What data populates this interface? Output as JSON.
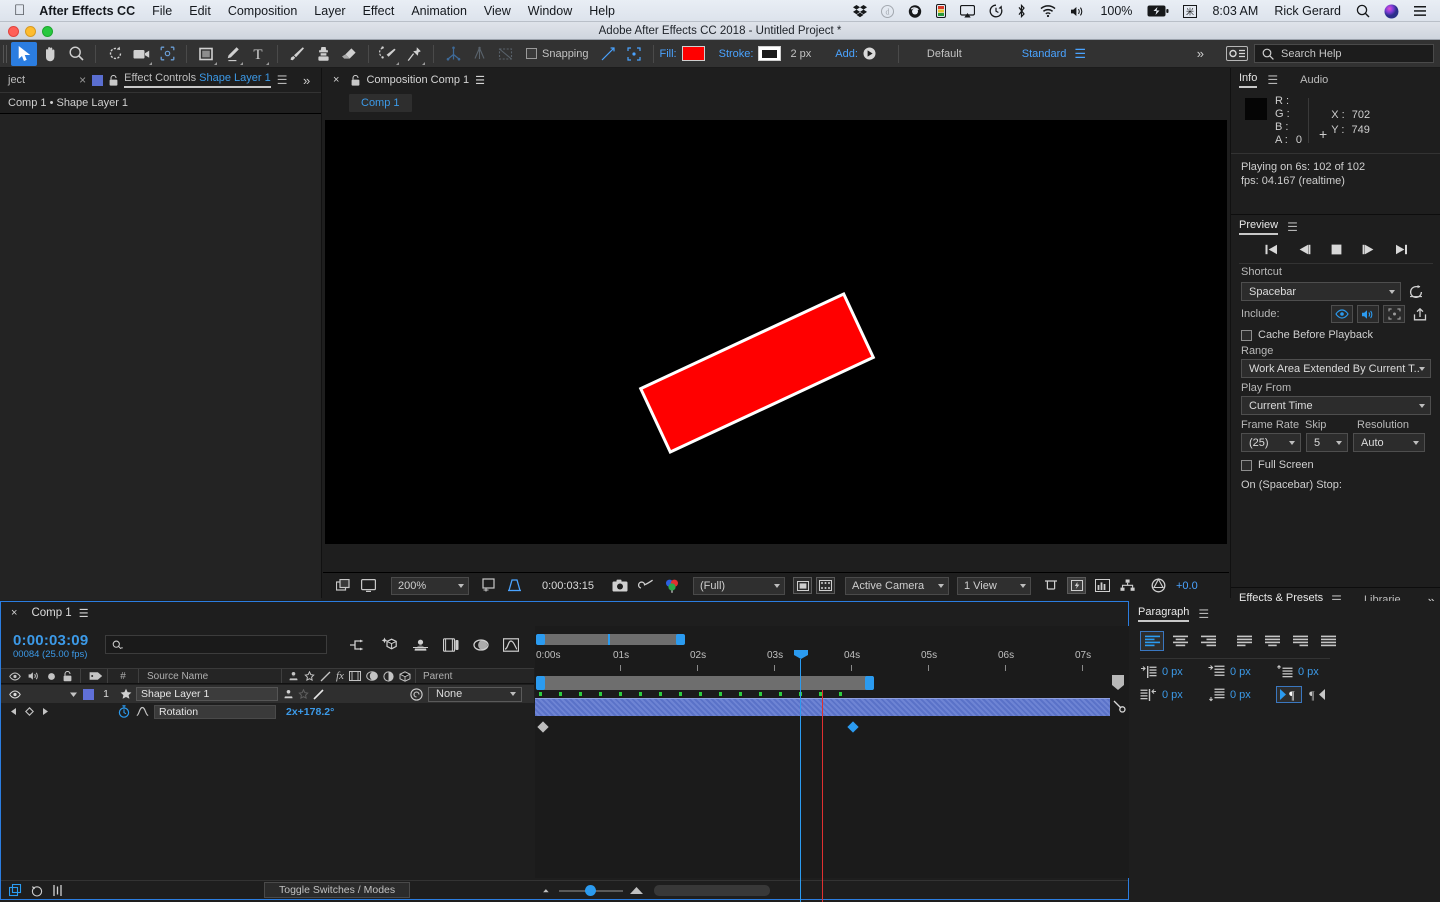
{
  "macbar": {
    "apple_icon": "apple-icon",
    "app_name": "After Effects CC",
    "menus": [
      "File",
      "Edit",
      "Composition",
      "Layer",
      "Effect",
      "Animation",
      "View",
      "Window",
      "Help"
    ],
    "status_icons": [
      "dropbox-icon",
      "dictation-icon",
      "creative-cloud-icon",
      "battery-monitor-icon",
      "airplay-icon",
      "timemachine-icon",
      "bluetooth-icon",
      "wifi-icon",
      "volume-icon"
    ],
    "battery_percent": "100%",
    "battery_icon": "battery-charging-icon",
    "keyboard_icon": "input-source-icon",
    "time": "8:03 AM",
    "user": "Rick Gerard",
    "search_icon": "spotlight-search-icon",
    "siri_icon": "siri-icon",
    "notification_icon": "notification-center-icon"
  },
  "titlebar": {
    "title": "Adobe After Effects CC 2018 - Untitled Project *"
  },
  "toolbar": {
    "tools": [
      {
        "name": "selection-tool",
        "glyph": "arrow",
        "active": true
      },
      {
        "name": "hand-tool",
        "glyph": "hand",
        "active": false
      },
      {
        "name": "zoom-tool",
        "glyph": "magnifier",
        "active": false
      },
      {
        "name": "rotation-tool",
        "glyph": "rotate",
        "active": false
      },
      {
        "name": "camera-tool",
        "glyph": "camera",
        "active": false
      },
      {
        "name": "pan-behind-tool",
        "glyph": "anchor",
        "active": false
      },
      {
        "name": "rectangle-tool",
        "glyph": "square",
        "active": false
      },
      {
        "name": "pen-tool",
        "glyph": "pen",
        "active": false
      },
      {
        "name": "type-tool",
        "glyph": "T",
        "active": false
      },
      {
        "name": "brush-tool",
        "glyph": "brush",
        "active": false
      },
      {
        "name": "clone-stamp-tool",
        "glyph": "stamp",
        "active": false
      },
      {
        "name": "eraser-tool",
        "glyph": "eraser",
        "active": false
      },
      {
        "name": "roto-brush-tool",
        "glyph": "roto",
        "active": false
      },
      {
        "name": "puppet-pin-tool",
        "glyph": "pin",
        "active": false
      }
    ],
    "snapping_label": "Snapping",
    "fill_label": "Fill:",
    "fill_color": "#ff0000",
    "stroke_label": "Stroke:",
    "stroke_color": "#ffffff",
    "stroke_width": "2 px",
    "add_label": "Add:",
    "workspace_default": "Default",
    "workspace_standard": "Standard",
    "search_placeholder": "Search Help",
    "overflow_icon": "chevron-double-right-icon",
    "workspace_icon": "workspace-settings-icon"
  },
  "effect_controls": {
    "project_tab": "ject",
    "title_prefix": "Effect Controls",
    "title_layer": "Shape Layer 1",
    "breadcrumb": "Comp 1 • Shape Layer 1",
    "lock_icon": "lock-icon",
    "menu_icon": "panel-menu-icon",
    "overflow_icon": "chevron-double-right-icon"
  },
  "composition": {
    "title_prefix": "Composition",
    "title_name": "Comp 1",
    "tab_label": "Comp 1",
    "lock_icon": "lock-icon",
    "menu_icon": "panel-menu-icon",
    "shape": {
      "fill": "#ff0000",
      "stroke": "#ffffff",
      "rotation_deg": -25
    },
    "viewer_bar": {
      "zoom": "200%",
      "time": "0:00:03:15",
      "resolution": "(Full)",
      "camera": "Active Camera",
      "views": "1 View",
      "exposure": "+0.0",
      "icons": [
        "always-preview-icon",
        "toggle-viewer-icon",
        "region-of-interest-icon",
        "transparency-grid-icon",
        "snapshot-icon",
        "show-snapshot-icon",
        "channel-icon",
        "mask-visibility-icon",
        "guide-icon",
        "renderer-icon",
        "3d-view-icon",
        "timeline-graph-icon",
        "comp-flowchart-icon",
        "exposure-icon"
      ]
    }
  },
  "info": {
    "tab_info": "Info",
    "tab_audio": "Audio",
    "r_label": "R :",
    "g_label": "G :",
    "b_label": "B :",
    "a_label": "A :",
    "a_value": "0",
    "x_label": "X :",
    "x_value": "702",
    "y_label": "Y :",
    "y_value": "749",
    "status_line1": "Playing on 6s: 102 of 102",
    "status_line2": "fps: 04.167 (realtime)",
    "swatch_color": "#050505"
  },
  "preview": {
    "title": "Preview",
    "transport": [
      "first-frame-icon",
      "previous-frame-icon",
      "stop-icon",
      "next-frame-icon",
      "last-frame-icon"
    ],
    "shortcut_label": "Shortcut",
    "shortcut_value": "Spacebar",
    "reset_icon": "reset-icon",
    "include_label": "Include:",
    "include_icons": [
      "video-eye-icon",
      "audio-speaker-icon",
      "overlays-icon"
    ],
    "share_icon": "share-icon",
    "cache_label": "Cache Before Playback",
    "range_label": "Range",
    "range_value": "Work Area Extended By Current T...",
    "play_from_label": "Play From",
    "play_from_value": "Current Time",
    "frame_rate_label": "Frame Rate",
    "frame_rate_value": "(25)",
    "skip_label": "Skip",
    "skip_value": "5",
    "resolution_label": "Resolution",
    "resolution_value": "Auto",
    "full_screen_label": "Full Screen",
    "on_stop_label": "On (Spacebar) Stop:"
  },
  "effects_presets": {
    "tab_effects": "Effects & Presets",
    "tab_libraries": "Librarie",
    "search_placeholder": "",
    "search_icon": "search-icon",
    "overflow_icon": "chevron-double-right-icon"
  },
  "timeline": {
    "tab_label": "Comp 1",
    "current_time": "0:00:03:09",
    "frame_info": "00084 (25.00 fps)",
    "search_placeholder": "",
    "switch_icons": [
      "composition-mini-flowchart-icon",
      "draft-3d-icon",
      "hide-shy-layers-icon",
      "frame-blending-icon",
      "motion-blur-icon",
      "graph-editor-icon"
    ],
    "columns": [
      "Source Name",
      "Parent"
    ],
    "column_icons": [
      "video-eye-icon",
      "audio-speaker-icon",
      "solo-icon",
      "lock-icon",
      "label-icon",
      "number-icon",
      "shy-icon",
      "collapse-icon",
      "quality-icon",
      "effects-fx-icon",
      "frame-blend-icon",
      "motion-blur-icon",
      "adjustment-icon",
      "3d-layer-icon"
    ],
    "layer": {
      "index": "1",
      "name": "Shape Layer 1",
      "parent": "None",
      "label_color": "#6070d8",
      "star_icon": "shape-layer-icon"
    },
    "property": {
      "name": "Rotation",
      "value": "2x+178.2°",
      "stopwatch_icon": "stopwatch-icon",
      "graph_icon": "value-graph-icon",
      "prev_key_icon": "previous-keyframe-icon",
      "key_icon": "keyframe-diamond-icon",
      "next_key_icon": "next-keyframe-icon"
    },
    "ruler_labels": [
      "0:00s",
      "01s",
      "02s",
      "03s",
      "04s",
      "05s",
      "06s",
      "07s"
    ],
    "keyframes_seconds": [
      0.0,
      3.6
    ],
    "footer": {
      "toggle_label": "Toggle Switches / Modes",
      "icons": [
        "comp-flowchart-icon",
        "frame-render-time-icon",
        "motion-blur-quality-icon"
      ]
    }
  },
  "paragraph": {
    "title": "Paragraph",
    "align_buttons": [
      "align-left",
      "align-center",
      "align-right",
      "justify-last-left",
      "justify-last-center",
      "justify-last-right",
      "justify-all"
    ],
    "indents": [
      {
        "name": "indent-left-margin",
        "value": "0 px"
      },
      {
        "name": "indent-first-line",
        "value": "0 px"
      },
      {
        "name": "space-before-paragraph",
        "value": "0 px"
      },
      {
        "name": "indent-right-margin",
        "value": "0 px"
      },
      {
        "name": "space-after-paragraph",
        "value": "0 px"
      }
    ],
    "direction_buttons": [
      "left-to-right-icon",
      "right-to-left-icon"
    ]
  }
}
